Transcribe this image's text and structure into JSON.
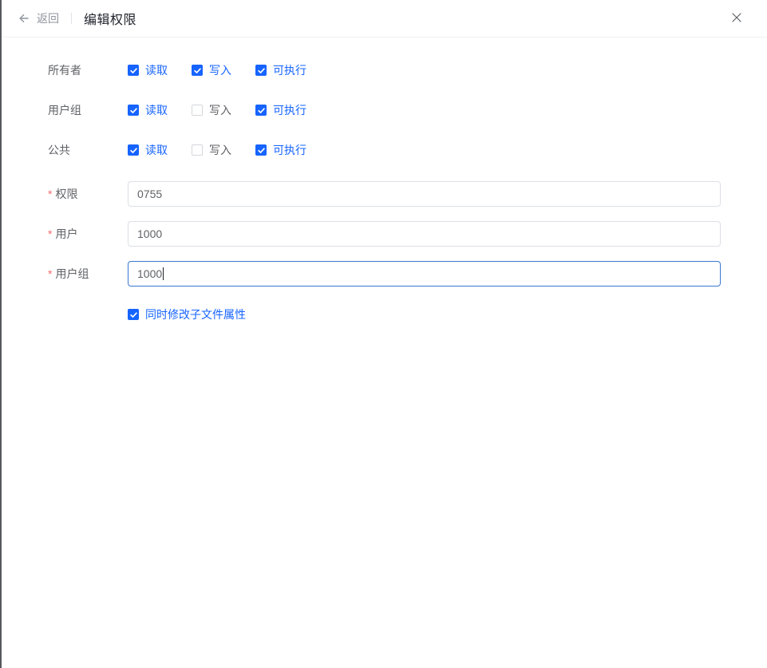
{
  "header": {
    "back_label": "返回",
    "title": "编辑权限"
  },
  "required_marker": "*",
  "permission_rows": [
    {
      "label": "所有者",
      "options": [
        {
          "label": "读取",
          "checked": true
        },
        {
          "label": "写入",
          "checked": true
        },
        {
          "label": "可执行",
          "checked": true
        }
      ]
    },
    {
      "label": "用户组",
      "options": [
        {
          "label": "读取",
          "checked": true
        },
        {
          "label": "写入",
          "checked": false
        },
        {
          "label": "可执行",
          "checked": true
        }
      ]
    },
    {
      "label": "公共",
      "options": [
        {
          "label": "读取",
          "checked": true
        },
        {
          "label": "写入",
          "checked": false
        },
        {
          "label": "可执行",
          "checked": true
        }
      ]
    }
  ],
  "fields": [
    {
      "label": "权限",
      "required": true,
      "value": "0755",
      "focused": false
    },
    {
      "label": "用户",
      "required": true,
      "value": "1000",
      "focused": false
    },
    {
      "label": "用户组",
      "required": true,
      "value": "1000",
      "focused": true
    }
  ],
  "footer_checkbox": {
    "label": "同时修改子文件属性",
    "checked": true
  },
  "colors": {
    "primary": "#1664ff",
    "danger": "#f56c6c",
    "focus-border": "#3a78d2"
  }
}
